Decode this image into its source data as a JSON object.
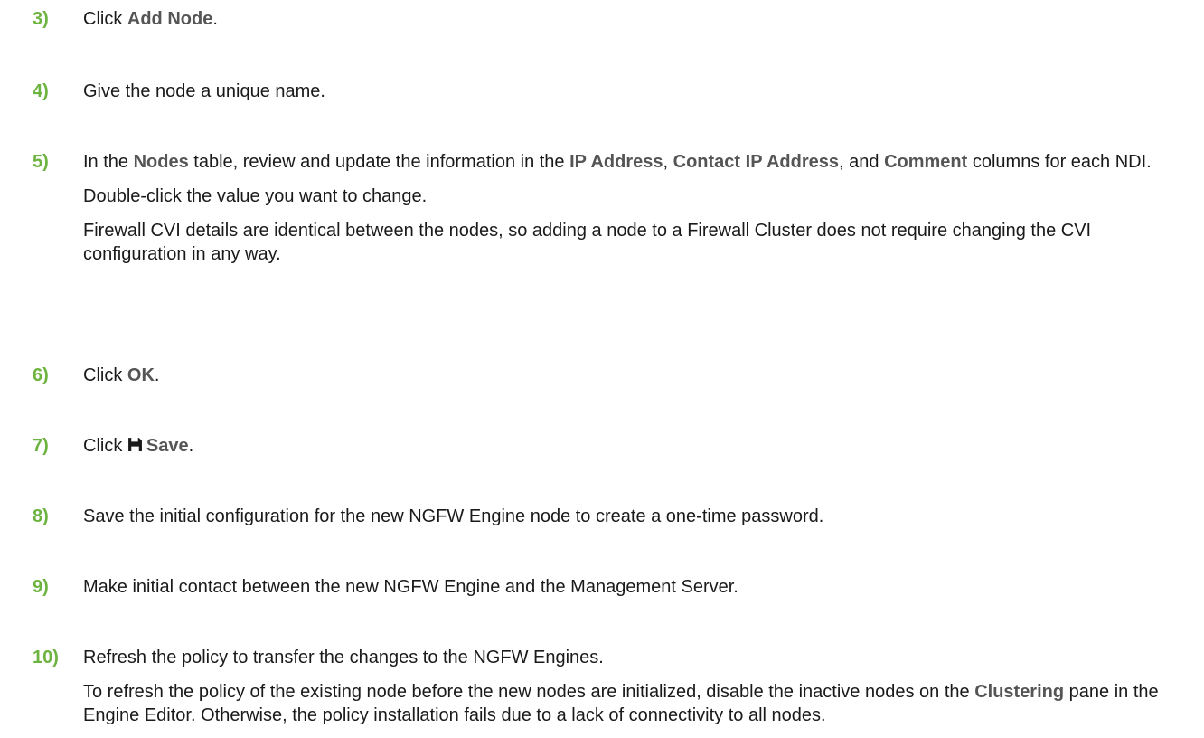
{
  "steps": [
    {
      "num": "3)",
      "parts": [
        "Click ",
        "Add Node",
        "."
      ]
    },
    {
      "num": "4)",
      "text": "Give the node a unique name."
    },
    {
      "num": "5)",
      "line1": [
        "In the ",
        "Nodes",
        " table, review and update the information in the ",
        "IP Address",
        ", ",
        "Contact IP Address",
        ", and ",
        "Comment",
        " columns for each NDI."
      ],
      "line2": "Double-click the value you want to change.",
      "line3": "Firewall CVI details are identical between the nodes, so adding a node to a Firewall Cluster does not require changing the CVI configuration in any way."
    },
    {
      "num": "6)",
      "parts": [
        "Click ",
        "OK",
        "."
      ]
    },
    {
      "num": "7)",
      "parts": [
        "Click ",
        "Save",
        "."
      ],
      "icon": "save-icon"
    },
    {
      "num": "8)",
      "text": "Save the initial configuration for the new NGFW Engine node to create a one-time password."
    },
    {
      "num": "9)",
      "text": "Make initial contact between the new NGFW Engine and the Management Server."
    },
    {
      "num": "10)",
      "line1": "Refresh the policy to transfer the changes to the NGFW Engines.",
      "line2": [
        "To refresh the policy of the existing node before the new nodes are initialized, disable the inactive nodes on the ",
        "Clustering",
        " pane in the Engine Editor. Otherwise, the policy installation fails due to a lack of connectivity to all nodes."
      ]
    }
  ]
}
